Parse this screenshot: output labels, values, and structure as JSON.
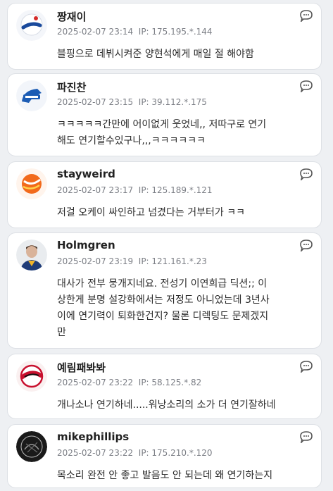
{
  "comments": [
    {
      "author": "짱재이",
      "date": "2025-02-07 23:14",
      "ip": "IP: 175.195.*.144",
      "lines": [
        "블핑으로 데뷔시켜준 양현석에게 매일 절 해야함"
      ],
      "avatar_icon": "dodgers-logo-icon"
    },
    {
      "author": "파진찬",
      "date": "2025-02-07 23:15",
      "ip": "IP: 39.112.*.175",
      "lines": [
        "ㅋㅋㅋㅋㅋ간만에 어이없게 웃었네,, 저따구로 연기",
        "해도 연기할수있구나,,,ㅋㅋㅋㅋㅋㅋ"
      ],
      "avatar_icon": "lions-logo-icon"
    },
    {
      "author": "stayweird",
      "date": "2025-02-07 23:17",
      "ip": "IP: 125.189.*.121",
      "lines": [
        "저걸 오케이 싸인하고 넘겼다는 거부터가 ㅋㅋ"
      ],
      "avatar_icon": "orange-ball-icon"
    },
    {
      "author": "Holmgren",
      "date": "2025-02-07 23:19",
      "ip": "IP: 121.161.*.23",
      "lines": [
        "대사가 전부 뭉개지네요. 전성기 이연희급 딕션;; 이",
        "상한게 분명 설강화에서는 저정도 아니었는데 3년사",
        "이에 연기력이 퇴화한건지? 물론 디렉팅도 문제겠지",
        "만"
      ],
      "avatar_icon": "player-photo-icon"
    },
    {
      "author": "예림패봐봐",
      "date": "2025-02-07 23:22",
      "ip": "IP: 58.125.*.82",
      "lines": [
        "개나소나 연기하네.....워낭소리의 소가 더 연기잘하네"
      ],
      "avatar_icon": "tigers-logo-icon"
    },
    {
      "author": "mikephillips",
      "date": "2025-02-07 23:22",
      "ip": "IP: 175.210.*.120",
      "lines": [
        "목소리 완전 안 좋고 발음도 안 되는데 왜 연기하는지"
      ],
      "avatar_icon": "dark-emblem-icon"
    }
  ],
  "colors": {
    "background": "#eef0f3",
    "card": "#ffffff",
    "meta_text": "#7c7f86"
  }
}
